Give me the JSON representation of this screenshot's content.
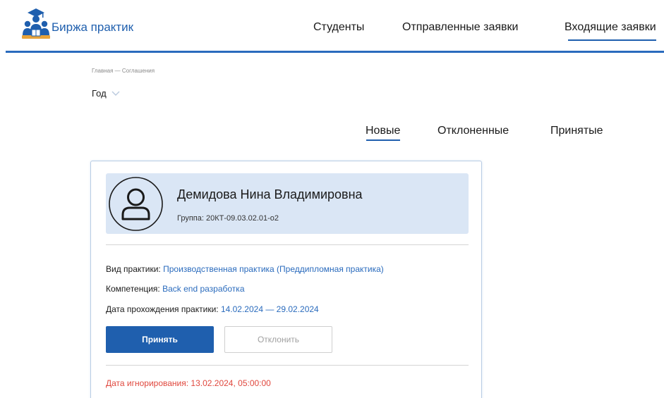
{
  "header": {
    "brand": "Биржа практик",
    "nav": {
      "students": "Студенты",
      "sent": "Отправленные заявки",
      "incoming": "Входящие заявки"
    },
    "colors": {
      "accent": "#1f5fae",
      "line": "#2a6bbd"
    }
  },
  "breadcrumb": "Главная — Соглашения",
  "filter": {
    "year_label": "Год"
  },
  "tabs": {
    "new": "Новые",
    "rejected": "Отклоненные",
    "accepted": "Принятые",
    "active": "new"
  },
  "card": {
    "student_name": "Демидова Нина Владимировна",
    "group": "Группа: 20КТ-09.03.02.01-о2",
    "practice_type_label": "Вид практики: ",
    "practice_type_value": "Производственная практика (Преддипломная практика)",
    "competence_label": "Компетенция: ",
    "competence_value": "Back end разработка",
    "dates_label": "Дата прохождения практики: ",
    "dates_value": "14.02.2024 — 29.02.2024",
    "accept_label": "Принять",
    "reject_label": "Отклонить",
    "ignore_date": "Дата игнорирования: 13.02.2024, 05:00:00",
    "colors": {
      "profile_bg": "#dae6f5",
      "value": "#2a6bbd",
      "warning": "#e0473d"
    }
  }
}
